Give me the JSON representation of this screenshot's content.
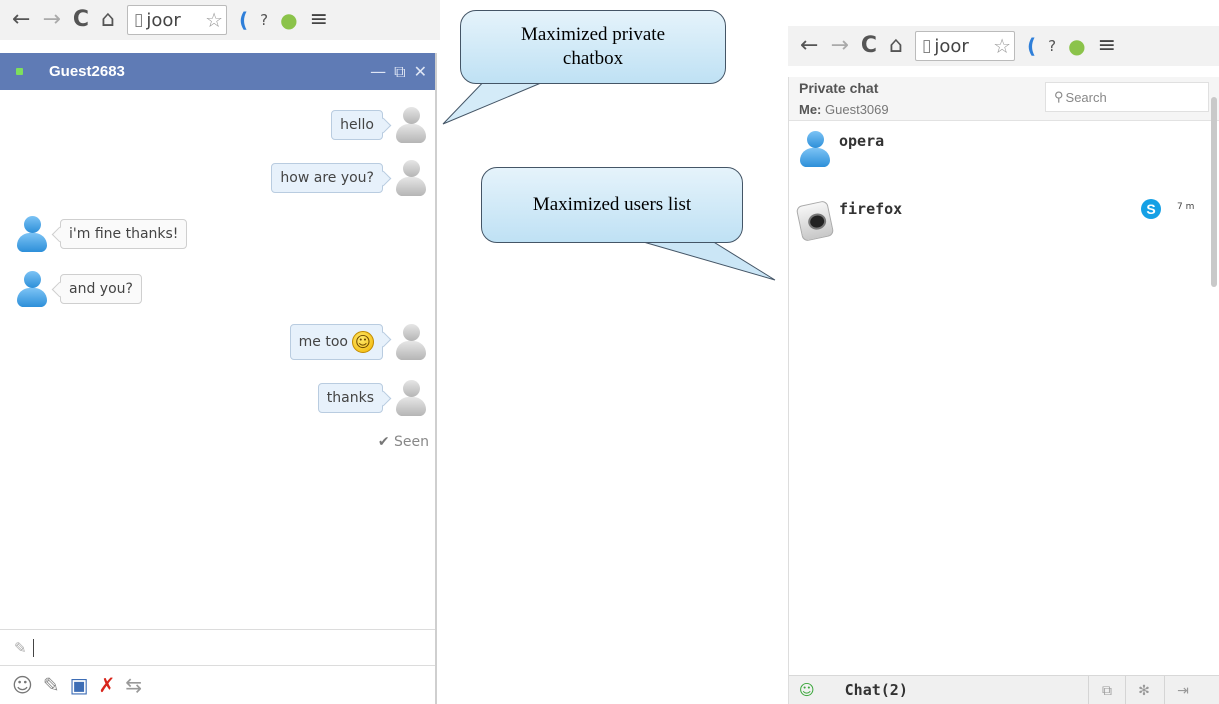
{
  "left_browser": {
    "nav": {
      "back": "←",
      "forward": "→",
      "reload": "C",
      "home": "⌂"
    },
    "omnibox_text": "joor",
    "extensions": {
      "jq": "(",
      "dl": "?",
      "android": "●",
      "menu": "≡"
    }
  },
  "chatbox": {
    "title": "Guest2683",
    "controls": {
      "minimize": "—",
      "restore": "⧉",
      "close": "✕"
    },
    "messages": [
      {
        "dir": "out",
        "text": "hello"
      },
      {
        "dir": "out",
        "text": "how are you?"
      },
      {
        "dir": "in",
        "text": "i'm fine thanks!"
      },
      {
        "dir": "in",
        "text": "and you?"
      },
      {
        "dir": "out",
        "text": "me too"
      },
      {
        "dir": "out",
        "text": "thanks"
      }
    ],
    "smiley": "☺",
    "seen_label": "Seen",
    "seen_check": "✔",
    "toolbar": {
      "emoji": "☺",
      "attach": "✎",
      "save": "▣",
      "delete": "✗",
      "swap": "⇆"
    },
    "pencil": "✎"
  },
  "callouts": {
    "private": "Maximized private chatbox",
    "users": "Maximized users list"
  },
  "right_browser": {
    "nav": {
      "back": "←",
      "forward": "→",
      "reload": "C",
      "home": "⌂"
    },
    "omnibox_text": "joor",
    "extensions": {
      "jq": "(",
      "dl": "?",
      "android": "●",
      "menu": "≡"
    }
  },
  "users_panel": {
    "title": "Private chat",
    "me_label": "Me:",
    "me_name": "Guest3069",
    "search_placeholder": "Search",
    "search_icon": "⚲",
    "users": [
      {
        "name": "opera"
      },
      {
        "name": "firefox",
        "badge": "S",
        "time": "7 m"
      }
    ],
    "footer": {
      "label": "Chat(2)",
      "icon": "☺",
      "btn_restore": "⧉",
      "btn_settings": "✻",
      "btn_logout": "⇥"
    }
  }
}
